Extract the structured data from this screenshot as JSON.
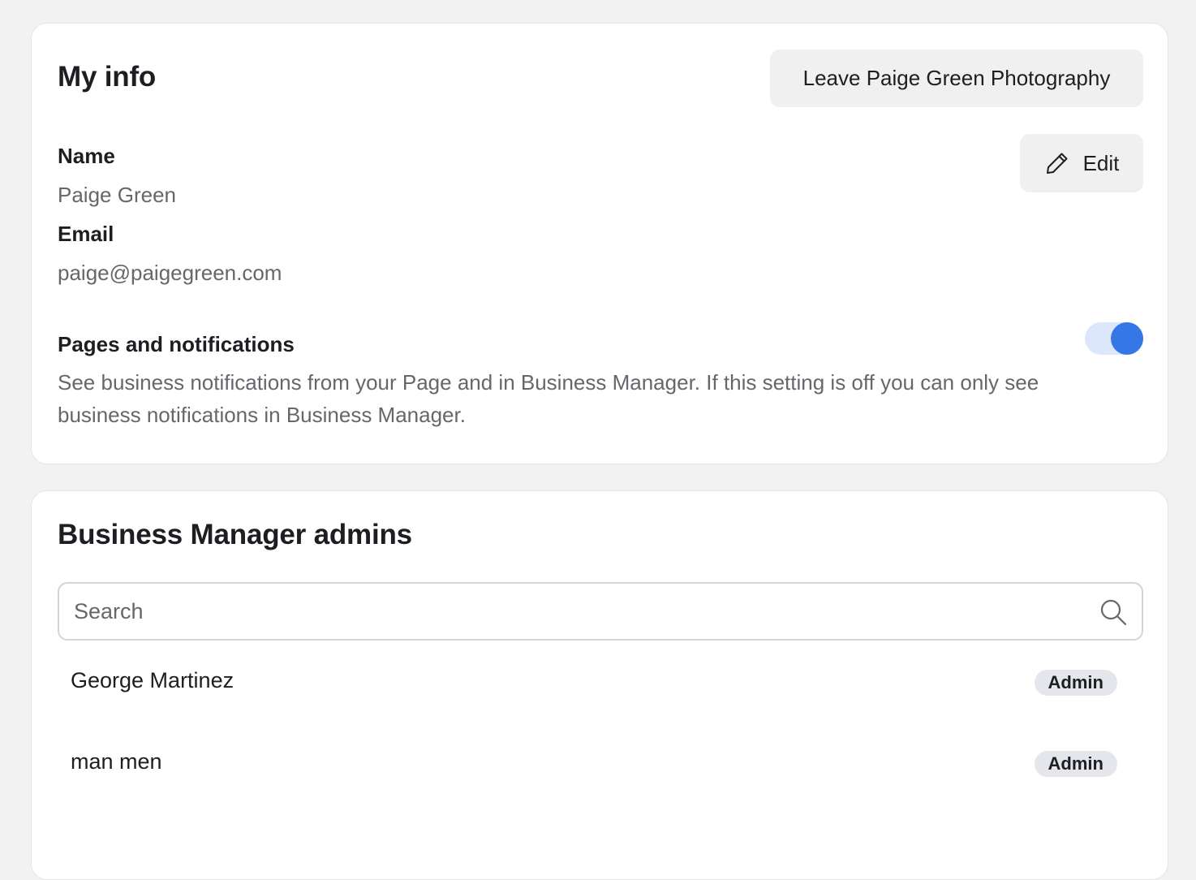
{
  "my_info": {
    "title": "My info",
    "leave_button": "Leave Paige Green Photography",
    "edit_button": "Edit",
    "name_label": "Name",
    "name_value": "Paige Green",
    "email_label": "Email",
    "email_value": "paige@paigegreen.com",
    "notifications_label": "Pages and notifications",
    "notifications_enabled": true,
    "notifications_description": "See business notifications from your Page and in Business Manager. If this setting is off you can only see business notifications in Business Manager."
  },
  "admins": {
    "title": "Business Manager admins",
    "search_placeholder": "Search",
    "search_value": "",
    "list": [
      {
        "name": "George Martinez",
        "role": "Admin"
      },
      {
        "name": "man men",
        "role": "Admin"
      }
    ]
  },
  "colors": {
    "accent": "#3578e5",
    "toggle_track": "#dce7fb",
    "page_background": "#f2f2f2",
    "secondary_text": "#65676b"
  },
  "icons": {
    "edit": "pencil-icon",
    "search": "search-icon"
  }
}
